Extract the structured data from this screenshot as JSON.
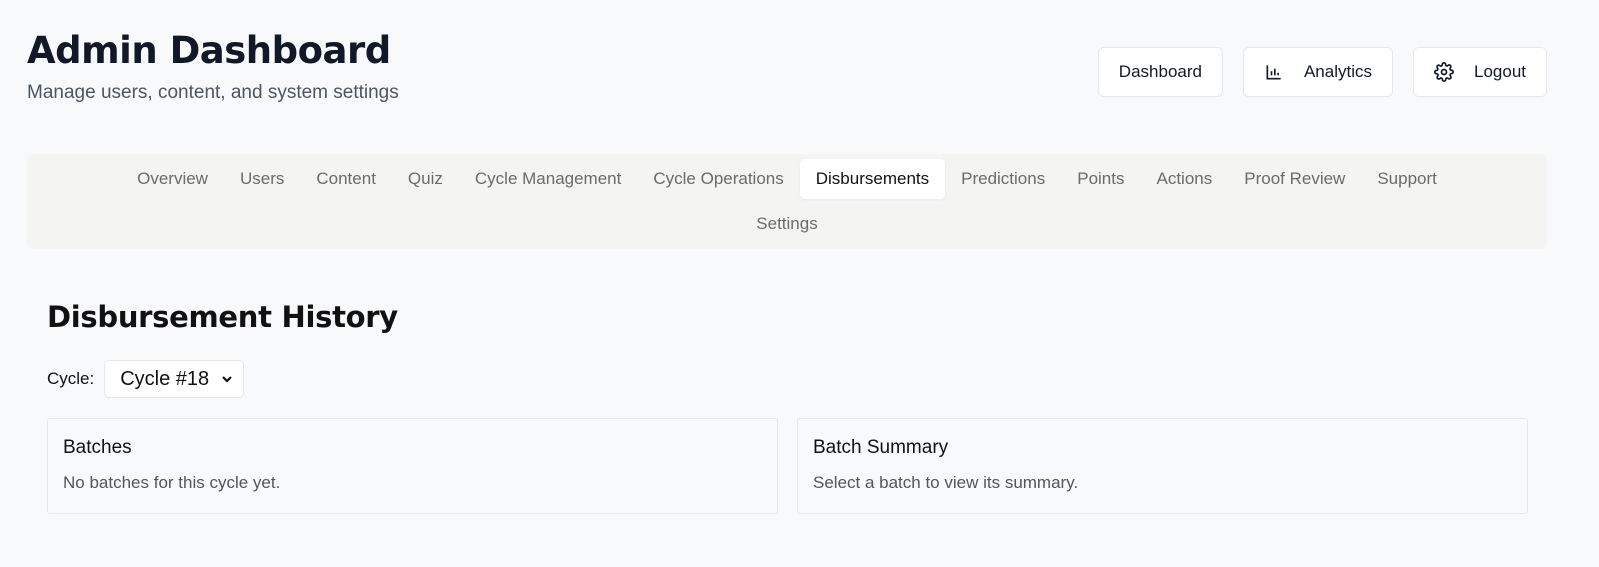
{
  "header": {
    "title": "Admin Dashboard",
    "subtitle": "Manage users, content, and system settings"
  },
  "actions": {
    "dashboard_label": "Dashboard",
    "analytics_label": "Analytics",
    "logout_label": "Logout",
    "analytics_icon": "bar-chart-icon",
    "logout_icon": "gear-icon"
  },
  "tabs": {
    "items": [
      "Overview",
      "Users",
      "Content",
      "Quiz",
      "Cycle Management",
      "Cycle Operations",
      "Disbursements",
      "Predictions",
      "Points",
      "Actions",
      "Proof Review",
      "Support",
      "Settings"
    ],
    "active": "Disbursements"
  },
  "main": {
    "section_title": "Disbursement History",
    "cycle_label": "Cycle:",
    "cycle_selected": "Cycle #18",
    "batches": {
      "title": "Batches",
      "message": "No batches for this cycle yet."
    },
    "summary": {
      "title": "Batch Summary",
      "message": "Select a batch to view its summary."
    }
  },
  "colors": {
    "background": "#f8f9fb",
    "tab_bar": "#f4f4f2",
    "text_primary": "#111827",
    "text_muted": "#4b5563"
  }
}
